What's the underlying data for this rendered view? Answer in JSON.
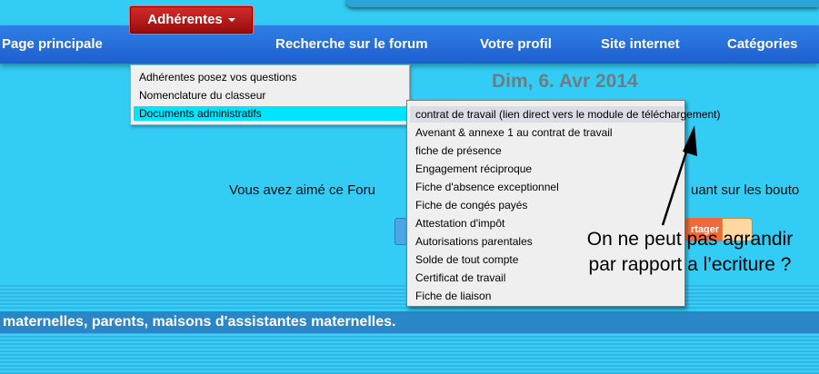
{
  "nav": {
    "items": [
      "Page principale",
      "Adhérentes",
      "Recherche sur le forum",
      "Votre profil",
      "Site internet",
      "Catégories"
    ],
    "active_index": 1
  },
  "dropdown": {
    "items": [
      "Adhérentes posez vos questions",
      "Nomenclature du classeur",
      "Documents administratifs"
    ],
    "highlighted_index": 2
  },
  "submenu": {
    "items": [
      "contrat de travail (lien direct vers le module de téléchargement)",
      "Avenant & annexe 1 au contrat de travail",
      "fiche de présence",
      "Engagement réciproque",
      "Fiche d'absence exceptionnel",
      "Fiche de congés payés",
      "Attestation d'impôt",
      "Autorisations parentales",
      "Solde de tout compte",
      "Certificat de travail",
      "Fiche de liaison"
    ]
  },
  "date": "Dim, 6. Avr 2014",
  "promo": {
    "left": "Vous avez aimé ce Foru",
    "right": "uant sur les bouto"
  },
  "share": {
    "label": "rtager"
  },
  "annotation": {
    "line1": "On ne peut pas agrandir",
    "line2": "par rapport a l’ecriture ?"
  },
  "footer": {
    "text": "maternelles, parents, maisons d'assistantes maternelles."
  },
  "colors": {
    "background": "#33ccf5",
    "navbar": "#1e5fd0",
    "active_tab": "#b81a1a",
    "highlight": "#00e5ff",
    "footer_bar": "#2a86c6"
  },
  "icons": {
    "dropdown_caret": "chevron-down-icon",
    "twitter": "twitter-icon",
    "share": "share-icon"
  }
}
